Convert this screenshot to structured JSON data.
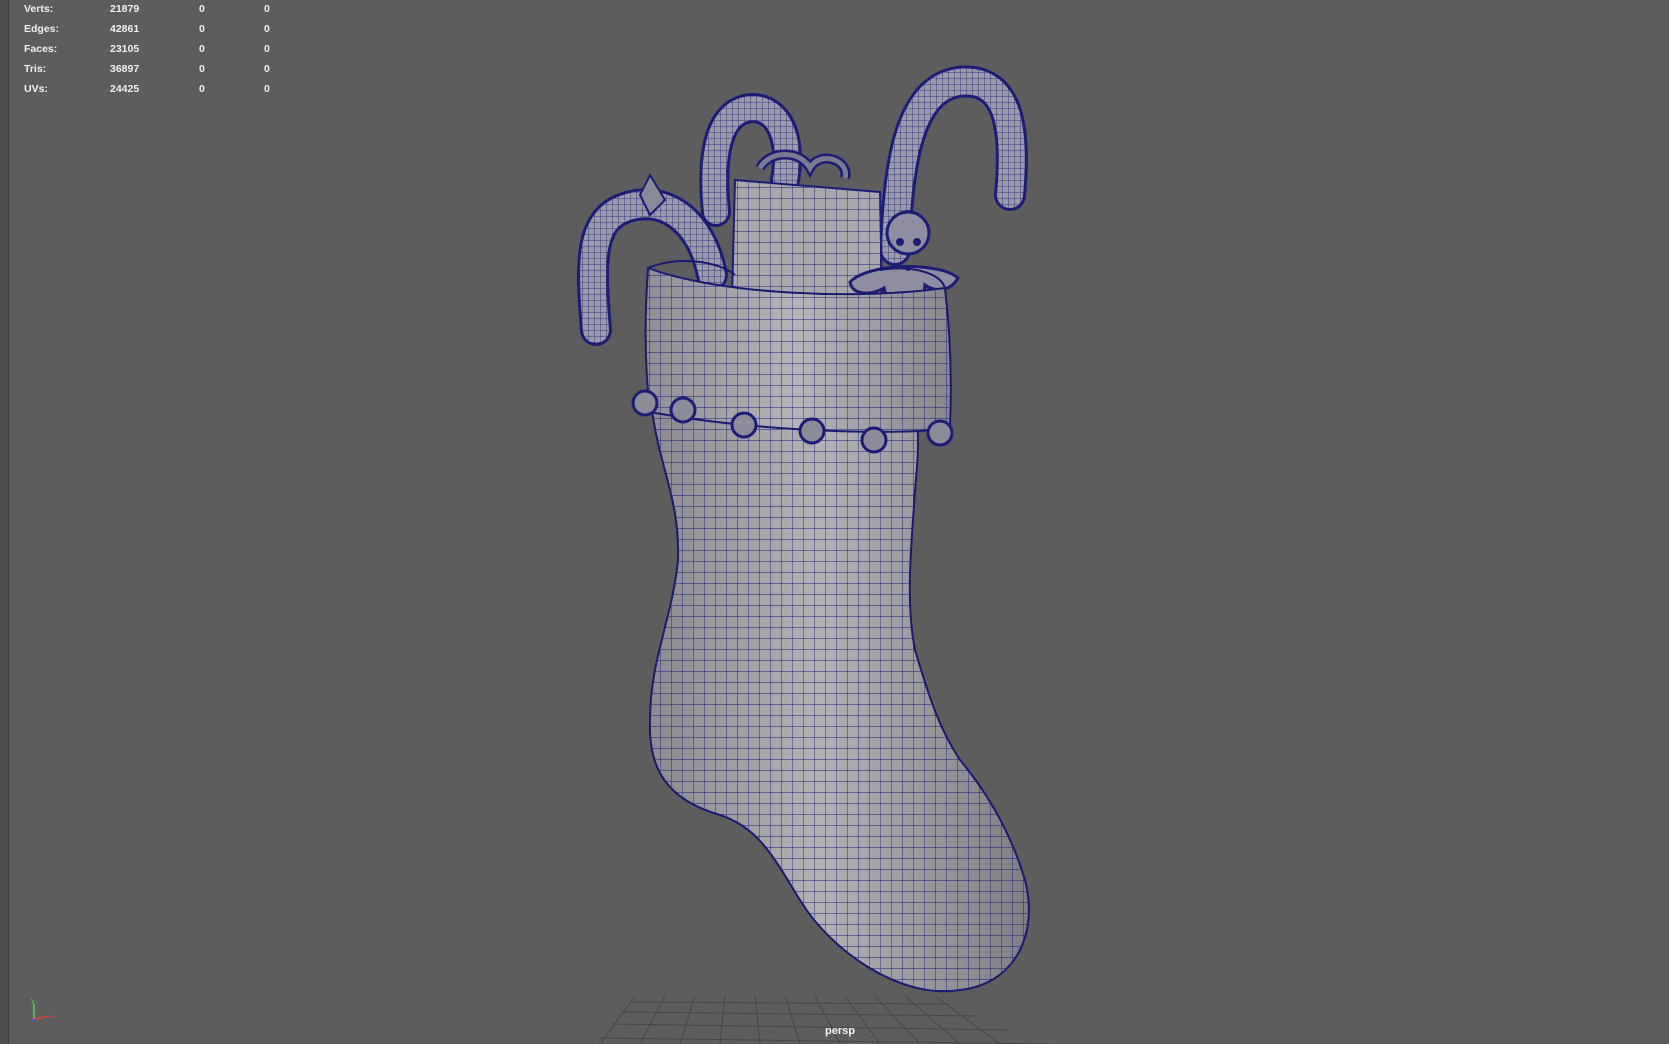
{
  "hud": {
    "rows": [
      {
        "label": "Verts:",
        "values": [
          "21879",
          "0",
          "0"
        ]
      },
      {
        "label": "Edges:",
        "values": [
          "42861",
          "0",
          "0"
        ]
      },
      {
        "label": "Faces:",
        "values": [
          "23105",
          "0",
          "0"
        ]
      },
      {
        "label": "Tris:",
        "values": [
          "36897",
          "0",
          "0"
        ]
      },
      {
        "label": "UVs:",
        "values": [
          "24425",
          "0",
          "0"
        ]
      }
    ]
  },
  "viewport": {
    "camera": "persp",
    "axis_labels": {
      "y": "y",
      "x": "x"
    }
  },
  "colors": {
    "background": "#5d5d5d",
    "wire": "#1a1a80",
    "surface": "#a4a4a8",
    "hud_text": "#f0f0f0",
    "axis_y": "#5fd35f",
    "axis_x": "#e04040",
    "axis_z": "#4060ff"
  },
  "icons": [
    "axis-gizmo-icon"
  ]
}
